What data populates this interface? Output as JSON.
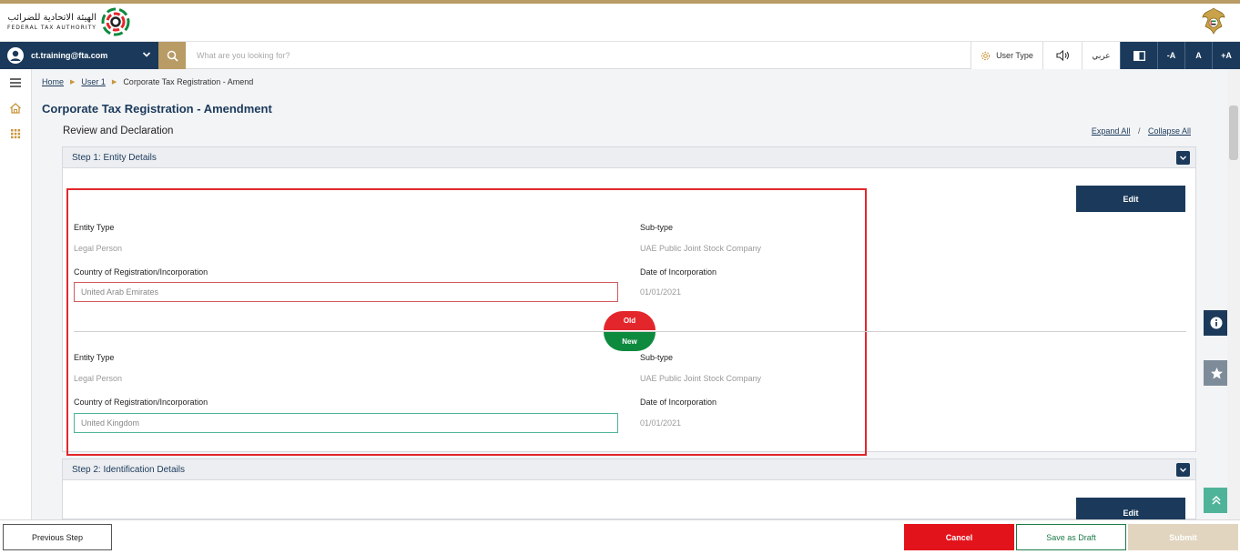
{
  "header": {
    "logo_ar": "الهيئة الاتحادية للضرائب",
    "logo_en": "FEDERAL TAX AUTHORITY"
  },
  "topbar": {
    "user_email": "ct.training@fta.com",
    "search_placeholder": "What are you looking for?",
    "user_type_label": "User Type",
    "language_label": "عربي",
    "font_decrease": "-A",
    "font_normal": "A",
    "font_increase": "+A"
  },
  "breadcrumb": {
    "home": "Home",
    "user": "User 1",
    "current": "Corporate Tax Registration - Amend"
  },
  "page": {
    "title": "Corporate Tax Registration - Amendment",
    "section_title": "Review and Declaration",
    "expand_all": "Expand All",
    "separator": "/",
    "collapse_all": "Collapse All"
  },
  "step1": {
    "title": "Step 1: Entity Details",
    "edit_label": "Edit",
    "old_badge": "Old",
    "new_badge": "New",
    "old": {
      "entity_type_label": "Entity Type",
      "entity_type_value": "Legal Person",
      "subtype_label": "Sub-type",
      "subtype_value": "UAE Public Joint Stock Company",
      "country_label": "Country of Registration/Incorporation",
      "country_value": "United Arab Emirates",
      "date_label": "Date of Incorporation",
      "date_value": "01/01/2021"
    },
    "new": {
      "entity_type_label": "Entity Type",
      "entity_type_value": "Legal Person",
      "subtype_label": "Sub-type",
      "subtype_value": "UAE Public Joint Stock Company",
      "country_label": "Country of Registration/Incorporation",
      "country_value": "United Kingdom",
      "date_label": "Date of Incorporation",
      "date_value": "01/01/2021"
    }
  },
  "step2": {
    "title": "Step 2: Identification Details",
    "edit_label": "Edit"
  },
  "footer": {
    "previous": "Previous Step",
    "cancel": "Cancel",
    "save_draft": "Save as Draft",
    "submit": "Submit"
  },
  "colors": {
    "primary": "#1b3a5b",
    "gold": "#b89b65",
    "cancel": "#e3131c",
    "old_badge": "#e3262b",
    "new_badge": "#0e8a3e",
    "submit_disabled": "#e2d5bf"
  },
  "icons": {
    "user": "user-circle-icon",
    "chevron": "chevron-down-icon",
    "search": "search-icon",
    "gear": "gear-icon",
    "speaker": "speaker-icon",
    "contrast": "contrast-icon",
    "menu": "hamburger-menu-icon",
    "home": "home-icon",
    "grid": "grid-icon",
    "info": "info-icon",
    "star": "star-icon",
    "scroll_top": "double-chevron-up-icon"
  }
}
